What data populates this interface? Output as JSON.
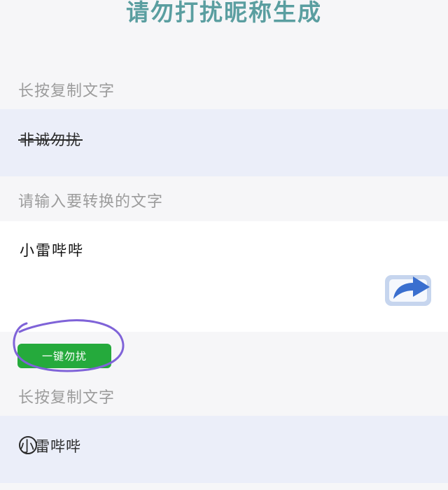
{
  "page": {
    "title": "请勿打扰昵称生成"
  },
  "top_result": {
    "label": "长按复制文字",
    "value": "非诚勿扰"
  },
  "input": {
    "label": "请输入要转换的文字",
    "value": "小雷哔哔"
  },
  "action": {
    "button_label": "一键勿扰",
    "share_icon": "share-arrow-icon",
    "button_color": "#25aa3c",
    "annotation_color": "#7f63d8"
  },
  "bottom_result": {
    "label": "长按复制文字",
    "value": "小雷哔哔"
  }
}
